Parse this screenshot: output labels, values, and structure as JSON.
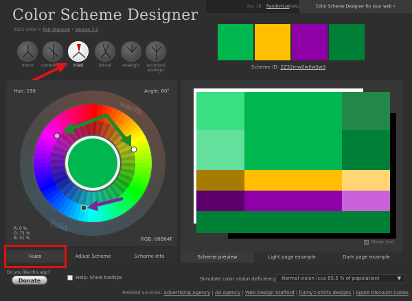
{
  "header": {
    "title": "Color Scheme Designer",
    "subtitle_prefix": "2002-2009 © ",
    "author_link": "Petr Stanicek",
    "subtitle_sep": " • ",
    "version_link": "Version 3.0",
    "fps": "fps: 18",
    "randomize": "Randomize",
    "setup": "[setup]",
    "tab": "Color Scheme Designer for your web »"
  },
  "modes": [
    {
      "label": "mono",
      "icon": "mono-icon"
    },
    {
      "label": "complement",
      "icon": "complement-icon"
    },
    {
      "label": "triad",
      "icon": "triad-icon",
      "active": true
    },
    {
      "label": "tetrad",
      "icon": "tetrad-icon"
    },
    {
      "label": "analogic",
      "icon": "analogic-icon"
    },
    {
      "label": "accented analogic",
      "icon": "accented-analogic-icon"
    }
  ],
  "swatches": [
    "#00b64f",
    "#ffbf00",
    "#8f00a8",
    "#007f37"
  ],
  "scheme_id_label": "Scheme ID:",
  "scheme_id": "2Z32mw0w0w0w0",
  "wheel": {
    "hue_label": "Hue:",
    "hue": "190",
    "angle_label": "Angle:",
    "angle": "60°",
    "warm": "warm",
    "cold": "cold",
    "r": "R:   0 %",
    "g": "G:  71 %",
    "b": "B:  31 %",
    "rgb_label": "RGB:",
    "rgb": "00B64F",
    "center_color": "#00b64f"
  },
  "left_tabs": [
    "Hues",
    "Adjust Scheme",
    "Scheme Info"
  ],
  "right_tabs": [
    "Scheme preview",
    "Light page example",
    "Dark page example"
  ],
  "donate_question": "Do you like this app?",
  "donate": "Donate",
  "help": "Help: Show tooltips",
  "show_text": "Show text",
  "preview_colors": {
    "primary": "#00b64f",
    "primary_light": "#39e184",
    "primary_lighter": "#65e09c",
    "primary_dark": "#007f37",
    "primary_mid": "#228849",
    "secondary": "#ffbf00",
    "secondary_dark": "#a67c00",
    "secondary_light": "#ffd673",
    "tertiary": "#8f00a8",
    "tertiary_dark": "#5d006d",
    "tertiary_light": "#c961d9"
  },
  "simulation": {
    "label": "Simulate color vision deficiency:",
    "value": "Normal vision (cca 85.5 % of population)"
  },
  "related": {
    "prefix": "Related sources:",
    "links": [
      "Advertising Agency",
      "Ad Agency",
      "Web Design Stafford",
      "funny t-shirts designs",
      "Apple Discount Codes"
    ]
  }
}
